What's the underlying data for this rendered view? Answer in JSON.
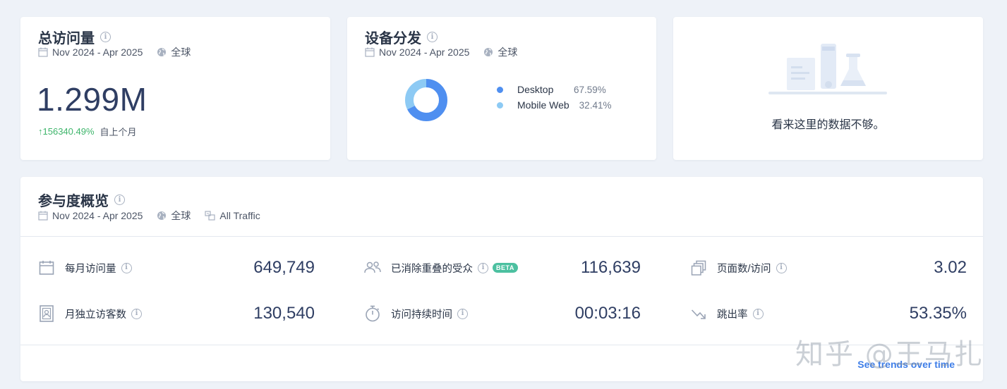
{
  "colors": {
    "desktop": "#4f8ff0",
    "mobile": "#8dcaf4",
    "up": "#3eb56b",
    "link": "#3e7ee8",
    "beta": "#4cc0a0"
  },
  "total_visits": {
    "title": "总访问量",
    "date_range": "Nov 2024 - Apr 2025",
    "region": "全球",
    "value": "1.299M",
    "change": "↑156340.49%",
    "change_label": "自上个月"
  },
  "device": {
    "title": "设备分发",
    "date_range": "Nov 2024 - Apr 2025",
    "region": "全球",
    "items": [
      {
        "name": "Desktop",
        "percent": "67.59%",
        "share": 0.6759
      },
      {
        "name": "Mobile Web",
        "percent": "32.41%",
        "share": 0.3241
      }
    ]
  },
  "empty_card": {
    "message": "看来这里的数据不够。"
  },
  "engagement": {
    "title": "参与度概览",
    "date_range": "Nov 2024 - Apr 2025",
    "region": "全球",
    "traffic": "All Traffic",
    "metrics": [
      {
        "label": "每月访问量",
        "value": "649,749",
        "icon": "calendar-icon"
      },
      {
        "label": "已消除重叠的受众",
        "value": "116,639",
        "icon": "users-icon",
        "badge": "BETA"
      },
      {
        "label": "页面数/访问",
        "value": "3.02",
        "icon": "pages-icon"
      },
      {
        "label": "月独立访客数",
        "value": "130,540",
        "icon": "id-card-icon"
      },
      {
        "label": "访问持续时间",
        "value": "00:03:16",
        "icon": "stopwatch-icon"
      },
      {
        "label": "跳出率",
        "value": "53.35%",
        "icon": "bounce-arrow-icon"
      }
    ],
    "see_trends": "See trends over time"
  },
  "watermark": "知乎 @王马扎"
}
